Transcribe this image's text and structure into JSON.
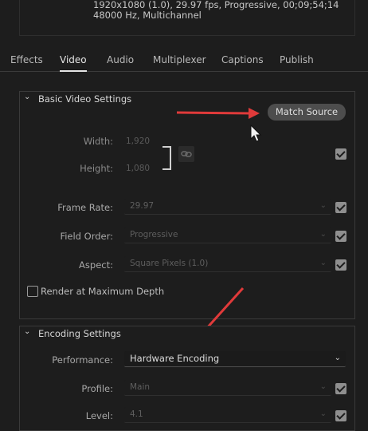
{
  "summary": {
    "line1": "1920x1080 (1.0), 29.97 fps, Progressive, 00;09;54;14",
    "line2": "48000 Hz, Multichannel"
  },
  "tabs": [
    {
      "label": "Effects"
    },
    {
      "label": "Video"
    },
    {
      "label": "Audio"
    },
    {
      "label": "Multiplexer"
    },
    {
      "label": "Captions"
    },
    {
      "label": "Publish"
    }
  ],
  "basic": {
    "title": "Basic Video Settings",
    "match_source": "Match Source",
    "width_label": "Width:",
    "width_value": "1,920",
    "height_label": "Height:",
    "height_value": "1,080",
    "frame_rate_label": "Frame Rate:",
    "frame_rate_value": "29.97",
    "field_order_label": "Field Order:",
    "field_order_value": "Progressive",
    "aspect_label": "Aspect:",
    "aspect_value": "Square Pixels (1.0)",
    "render_max_depth": "Render at Maximum Depth"
  },
  "encoding": {
    "title": "Encoding Settings",
    "performance_label": "Performance:",
    "performance_value": "Hardware Encoding",
    "profile_label": "Profile:",
    "profile_value": "Main",
    "level_label": "Level:",
    "level_value": "4.1"
  },
  "colors": {
    "background": "#1d1d1d",
    "arrow": "#e03a3a",
    "button": "#4d4d4d"
  }
}
